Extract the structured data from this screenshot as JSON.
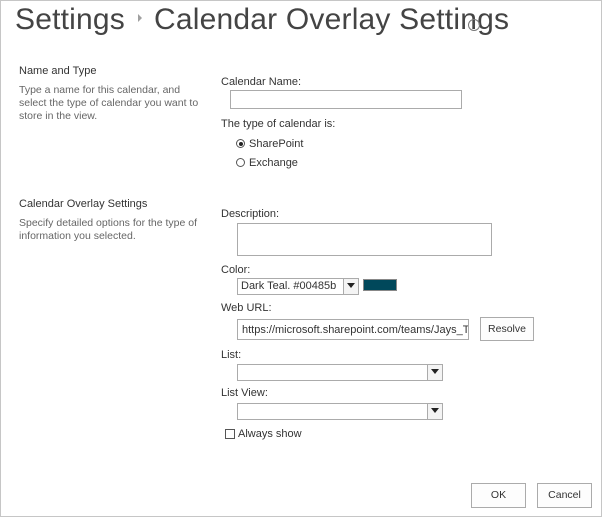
{
  "header": {
    "crumb_root": "Settings",
    "page_title": "Calendar Overlay Settings",
    "info_glyph": "i"
  },
  "name_section": {
    "title": "Name and Type",
    "description": "Type a name for this calendar, and select the type of calendar you want to store in the view.",
    "calendar_name_label": "Calendar Name:",
    "calendar_name_value": "",
    "type_label": "The type of calendar is:",
    "types": [
      {
        "label": "SharePoint",
        "selected": true
      },
      {
        "label": "Exchange",
        "selected": false
      }
    ]
  },
  "overlay_section": {
    "title": "Calendar Overlay Settings",
    "description": "Specify detailed options for the type of information you selected.",
    "description_label": "Description:",
    "description_value": "",
    "color_label": "Color:",
    "color_value": "Dark Teal. #00485b",
    "color_swatch": "#00485b",
    "web_url_label": "Web URL:",
    "web_url_value": "https://microsoft.sharepoint.com/teams/Jays_Team",
    "resolve_label": "Resolve",
    "list_label": "List:",
    "list_value": "",
    "list_view_label": "List View:",
    "list_view_value": "",
    "always_show_label": "Always show",
    "always_show_checked": false
  },
  "footer": {
    "ok_label": "OK",
    "cancel_label": "Cancel"
  },
  "icons": {
    "info": "info-icon",
    "breadcrumb_separator": "triangle-right-icon",
    "dropdown": "chevron-down-icon"
  }
}
